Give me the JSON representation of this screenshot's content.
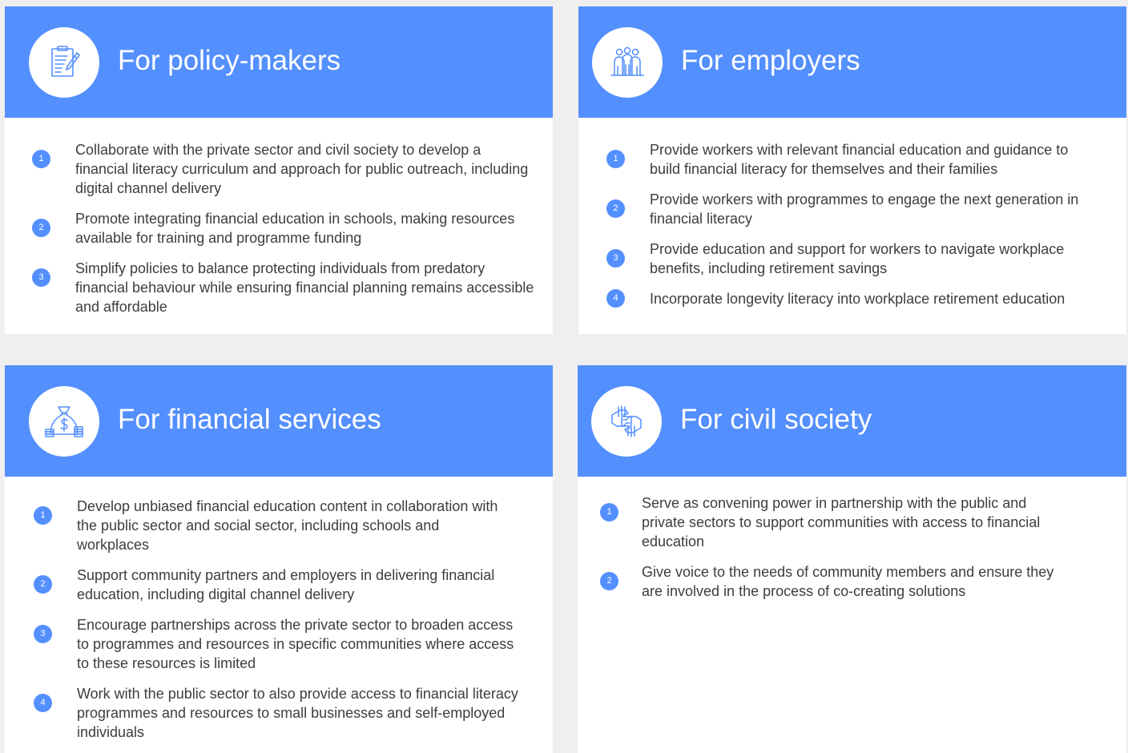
{
  "colors": {
    "accent": "#548ffe",
    "background": "#efefef",
    "card": "#ffffff",
    "text": "#3d3d3d"
  },
  "cards": {
    "policy": {
      "icon": "clipboard-pen-icon",
      "title": "For policy-makers",
      "items": [
        {
          "num": "1",
          "text": "Collaborate with the private sector and civil society to develop a financial literacy curriculum and approach for public outreach, including digital channel delivery"
        },
        {
          "num": "2",
          "text": "Promote integrating financial education in schools, making resources available for training and programme funding"
        },
        {
          "num": "3",
          "text": "Simplify policies to balance protecting individuals from predatory financial behaviour while ensuring financial planning remains accessible and affordable"
        }
      ]
    },
    "employers": {
      "icon": "group-people-icon",
      "title": "For employers",
      "items": [
        {
          "num": "1",
          "text": "Provide workers with relevant financial education and guidance to build financial literacy for themselves and their families"
        },
        {
          "num": "2",
          "text": "Provide workers with programmes to engage the next generation in financial literacy"
        },
        {
          "num": "3",
          "text": "Provide education and support for workers to navigate workplace benefits, including retirement savings"
        },
        {
          "num": "4",
          "text": "Incorporate longevity literacy into workplace retirement education"
        }
      ]
    },
    "financial": {
      "icon": "money-bag-icon",
      "title": "For financial services",
      "items": [
        {
          "num": "1",
          "text": "Develop unbiased financial education content in collaboration with the public sector and social sector, including schools and workplaces"
        },
        {
          "num": "2",
          "text": "Support community partners and employers in delivering financial education, including digital channel delivery"
        },
        {
          "num": "3",
          "text": "Encourage partnerships across the private sector to broaden access to programmes and resources in specific communities where access to these resources is limited"
        },
        {
          "num": "4",
          "text": "Work with the public sector to also provide access to financial literacy programmes and resources to small businesses and self-employed individuals"
        }
      ]
    },
    "civil": {
      "icon": "joined-hands-icon",
      "title": "For civil society",
      "items": [
        {
          "num": "1",
          "text": "Serve as convening power in partnership with the public and private sectors to support communities with access to financial education"
        },
        {
          "num": "2",
          "text": "Give voice to the needs of community members and ensure they are involved in the process of co-creating solutions"
        }
      ]
    }
  }
}
